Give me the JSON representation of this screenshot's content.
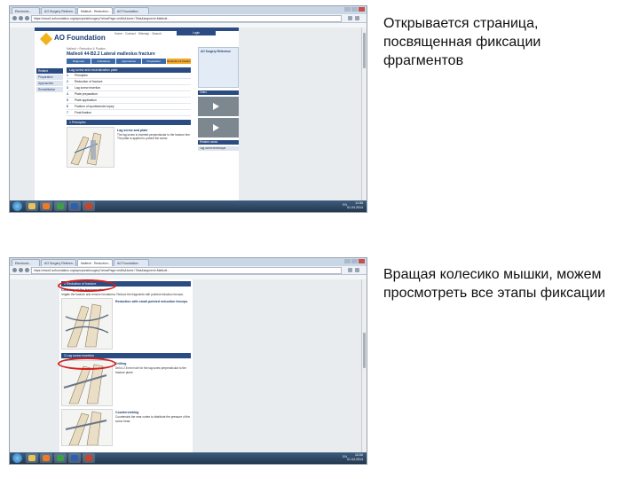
{
  "captions": {
    "first": "Открывается страница, посвященная фиксации фрагментов",
    "second": "Вращая колесико мышки, можем просмотреть все этапы фиксации"
  },
  "browser": {
    "tabs": [
      "Electronic...",
      "AO Surgery Referen...",
      "Malleoli - Reduction...",
      "AO Foundation"
    ],
    "url": "https://www2.aofoundation.org/wps/portal/surgery?showPage=redfix&bone=Tibia&segment=Malleoli...",
    "taskbar_clock_1": {
      "time": "11:55",
      "date": "01.04.2014"
    },
    "taskbar_clock_2": {
      "time": "12:00",
      "date": "01.04.2014"
    },
    "tray_lang": "EN"
  },
  "page": {
    "logo_text": "AO Foundation",
    "toplinks": "Home · Contact · Sitemap · Search",
    "login": "Login",
    "title": "Malleoli 44-B2.2 Lateral malleolus fracture",
    "breadcrumb": "Malleoli > Reduction & Fixation",
    "nav_tabs": [
      "Diagnosis",
      "Indications",
      "Approaches",
      "Preparation",
      "Reduction & fixation"
    ],
    "side_head": "Related",
    "side_items": [
      "Preparation",
      "Approaches",
      "Rehabilitation"
    ],
    "steps_title": "Lag screw and neutralization plate",
    "steps": [
      {
        "num": "1",
        "label": "Principles"
      },
      {
        "num": "2",
        "label": "Reduction of fracture"
      },
      {
        "num": "3",
        "label": "Lag screw insertion"
      },
      {
        "num": "4",
        "label": "Plate preparation"
      },
      {
        "num": "5",
        "label": "Plate application"
      },
      {
        "num": "6",
        "label": "Fixation of syndesmotic injury"
      },
      {
        "num": "7",
        "label": "Final fixation"
      }
    ],
    "section1": "1  Principles",
    "principles_sub": "Lag screw and plate",
    "principles_text": "The lag screw is inserted perpendicular to the fracture line. The plate is applied to protect the screw.",
    "right_box_1": "AO Surgery Reference",
    "right_video_label": "Video",
    "right_box_2": "Related cases",
    "right_box_3": "Lag screw technique"
  },
  "page2": {
    "section2": "2  Reduction of fracture",
    "sub2": "Cleaning of the fracture site",
    "text2": "Irrigate the fracture and remove hematoma. Reduce the fragments with pointed reduction forceps.",
    "sub2b": "Reduction with small pointed reduction forceps",
    "section3": "3  Lag screw insertion",
    "sub3": "Drilling",
    "text3": "Drill a 2.5 mm hole for the lag screw perpendicular to the fracture plane.",
    "sub3b": "Countersinking",
    "text3b": "Countersink the near cortex to distribute the pressure of the screw head."
  }
}
